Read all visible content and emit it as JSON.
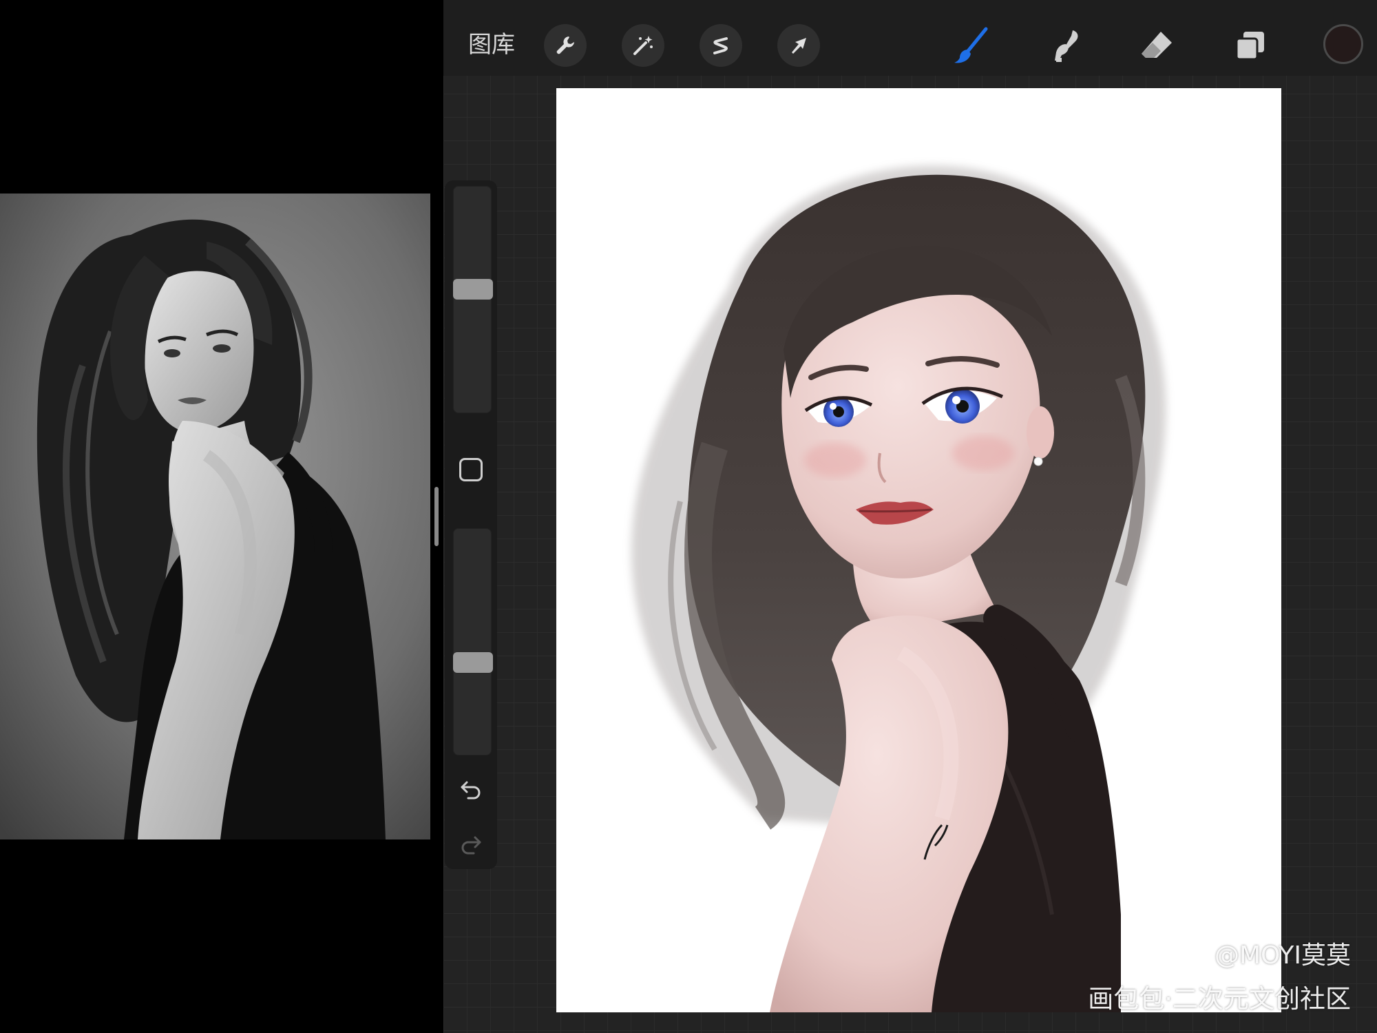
{
  "top_bar": {
    "gallery_label": "图库",
    "tools": [
      {
        "name": "actions",
        "icon": "wrench-icon"
      },
      {
        "name": "adjustments",
        "icon": "magic-wand-icon"
      },
      {
        "name": "selection",
        "icon": "selection-s-icon"
      },
      {
        "name": "transform",
        "icon": "arrow-cursor-icon"
      },
      {
        "name": "brush",
        "icon": "brush-icon"
      },
      {
        "name": "smudge",
        "icon": "smudge-finger-icon"
      },
      {
        "name": "eraser",
        "icon": "eraser-icon"
      },
      {
        "name": "layers",
        "icon": "layers-icon"
      }
    ],
    "active_tool": "brush",
    "active_color": "#241a1a",
    "accent_color": "#1e6fe8"
  },
  "side_bar": {
    "brush_size_level": 0.55,
    "opacity_level": 0.4,
    "undo_icon": "undo-arrow-icon",
    "redo_icon": "redo-arrow-icon"
  },
  "watermark": {
    "author": "@MOYI莫莫",
    "site": "画包包·二次元文创社区"
  }
}
